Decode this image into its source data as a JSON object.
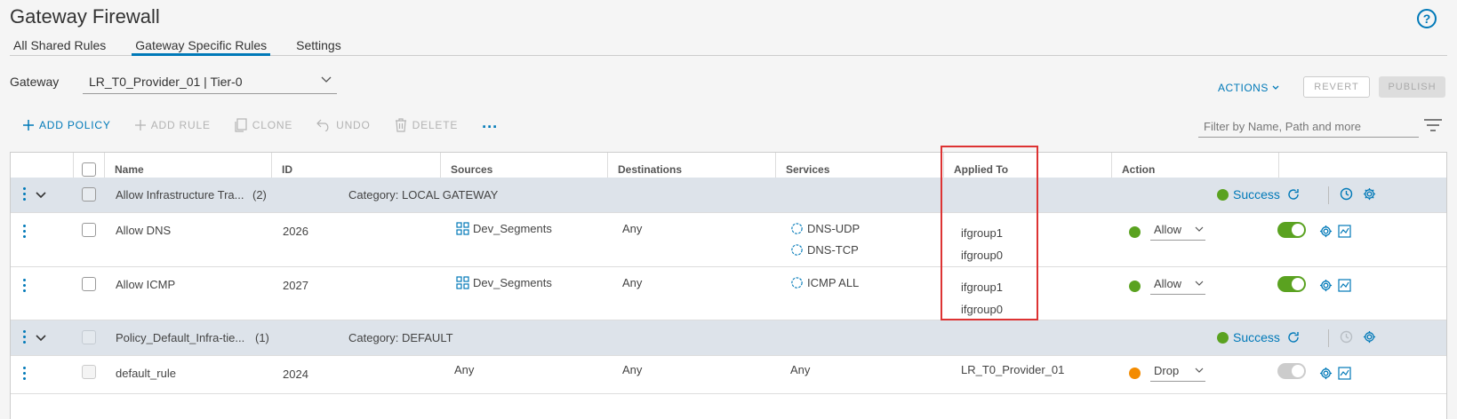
{
  "page": {
    "title": "Gateway Firewall",
    "help_icon": "help-icon"
  },
  "tabs": [
    {
      "label": "All Shared Rules",
      "active": false
    },
    {
      "label": "Gateway Specific Rules",
      "active": true
    },
    {
      "label": "Settings",
      "active": false
    }
  ],
  "gateway": {
    "label": "Gateway",
    "selected": "LR_T0_Provider_01 | Tier-0"
  },
  "top_actions": {
    "actions": "ACTIONS",
    "revert": "REVERT",
    "publish": "PUBLISH"
  },
  "toolbar": {
    "add_policy": "ADD POLICY",
    "add_rule": "ADD RULE",
    "clone": "CLONE",
    "undo": "UNDO",
    "delete": "DELETE",
    "more": "..."
  },
  "filter": {
    "placeholder": "Filter by Name, Path and more"
  },
  "columns": {
    "name": "Name",
    "id": "ID",
    "sources": "Sources",
    "destinations": "Destinations",
    "services": "Services",
    "applied_to": "Applied To",
    "action": "Action"
  },
  "policies": [
    {
      "name": "Allow Infrastructure Tra...",
      "count": "(2)",
      "category": "Category: LOCAL GATEWAY",
      "status": "Success",
      "rules": [
        {
          "name": "Allow DNS",
          "id": "2026",
          "sources": "Dev_Segments",
          "destinations": "Any",
          "services": [
            "DNS-UDP",
            "DNS-TCP"
          ],
          "applied_to": [
            "ifgroup1",
            "ifgroup0"
          ],
          "action": "Allow",
          "enabled": true
        },
        {
          "name": "Allow ICMP",
          "id": "2027",
          "sources": "Dev_Segments",
          "destinations": "Any",
          "services": [
            "ICMP ALL"
          ],
          "applied_to": [
            "ifgroup1",
            "ifgroup0"
          ],
          "action": "Allow",
          "enabled": true
        }
      ]
    },
    {
      "name": "Policy_Default_Infra-tie...",
      "count": "(1)",
      "category": "Category: DEFAULT",
      "status": "Success",
      "rules": [
        {
          "name": "default_rule",
          "id": "2024",
          "sources": "Any",
          "destinations": "Any",
          "services": [
            "Any"
          ],
          "applied_to": [
            "LR_T0_Provider_01"
          ],
          "action": "Drop",
          "enabled": false
        }
      ]
    }
  ],
  "colors": {
    "accent": "#0079b8",
    "allow": "#5aa220",
    "drop": "#f38b00",
    "group_row": "#dde3ea",
    "highlight": "#dd3333"
  }
}
